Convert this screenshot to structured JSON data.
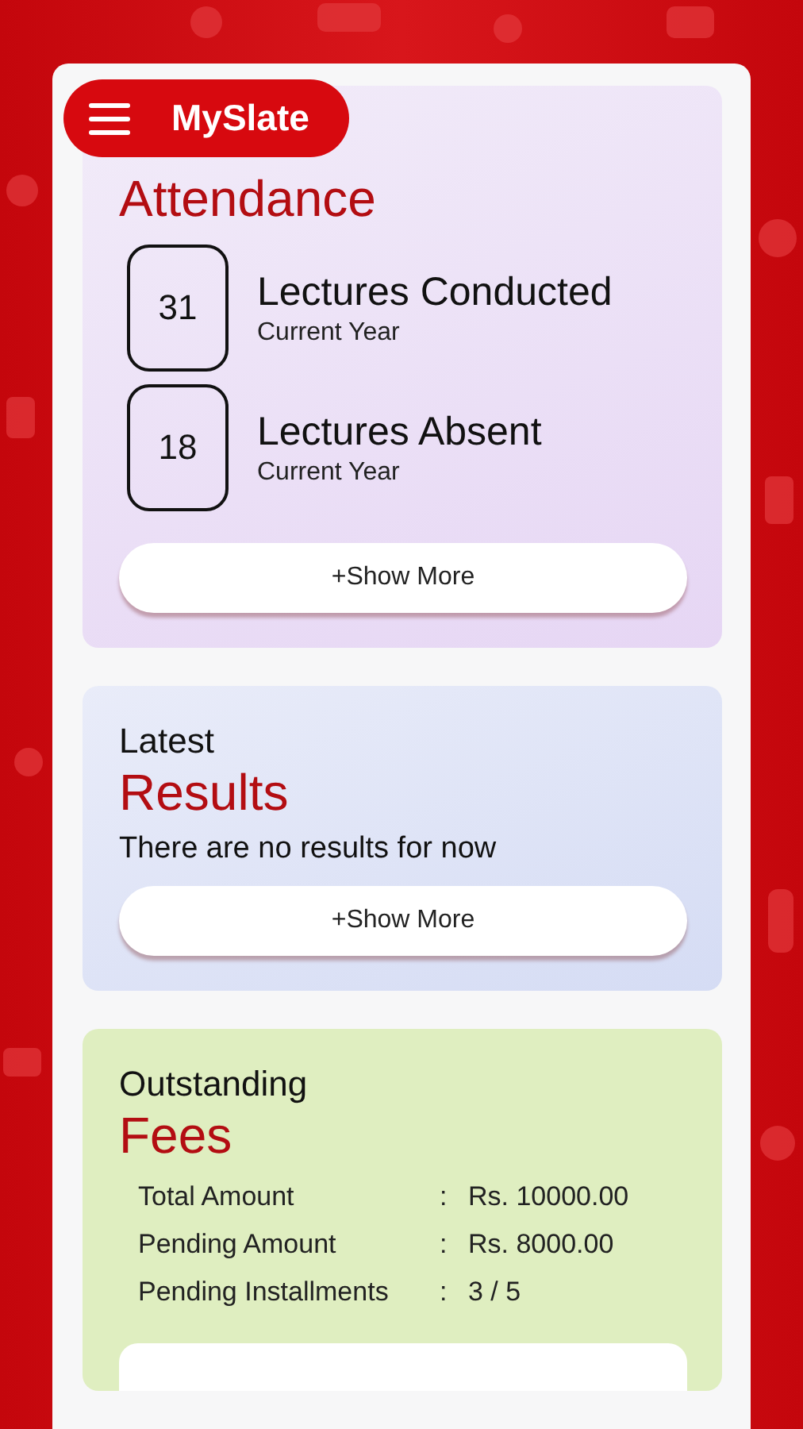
{
  "app_bar": {
    "title": "MySlate"
  },
  "attendance": {
    "title": "Attendance",
    "stats": [
      {
        "value": "31",
        "label": "Lectures Conducted",
        "sublabel": "Current Year"
      },
      {
        "value": "18",
        "label": "Lectures Absent",
        "sublabel": "Current Year"
      }
    ],
    "button": "+Show More"
  },
  "results": {
    "overline": "Latest",
    "title": "Results",
    "message": "There are no results for now",
    "button": "+Show More"
  },
  "fees": {
    "overline": "Outstanding",
    "title": "Fees",
    "rows": [
      {
        "label": "Total Amount",
        "separator": ":",
        "value": "Rs. 10000.00"
      },
      {
        "label": "Pending Amount",
        "separator": ":",
        "value": "Rs. 8000.00"
      },
      {
        "label": "Pending Installments",
        "separator": ":",
        "value": "3 / 5"
      }
    ]
  }
}
